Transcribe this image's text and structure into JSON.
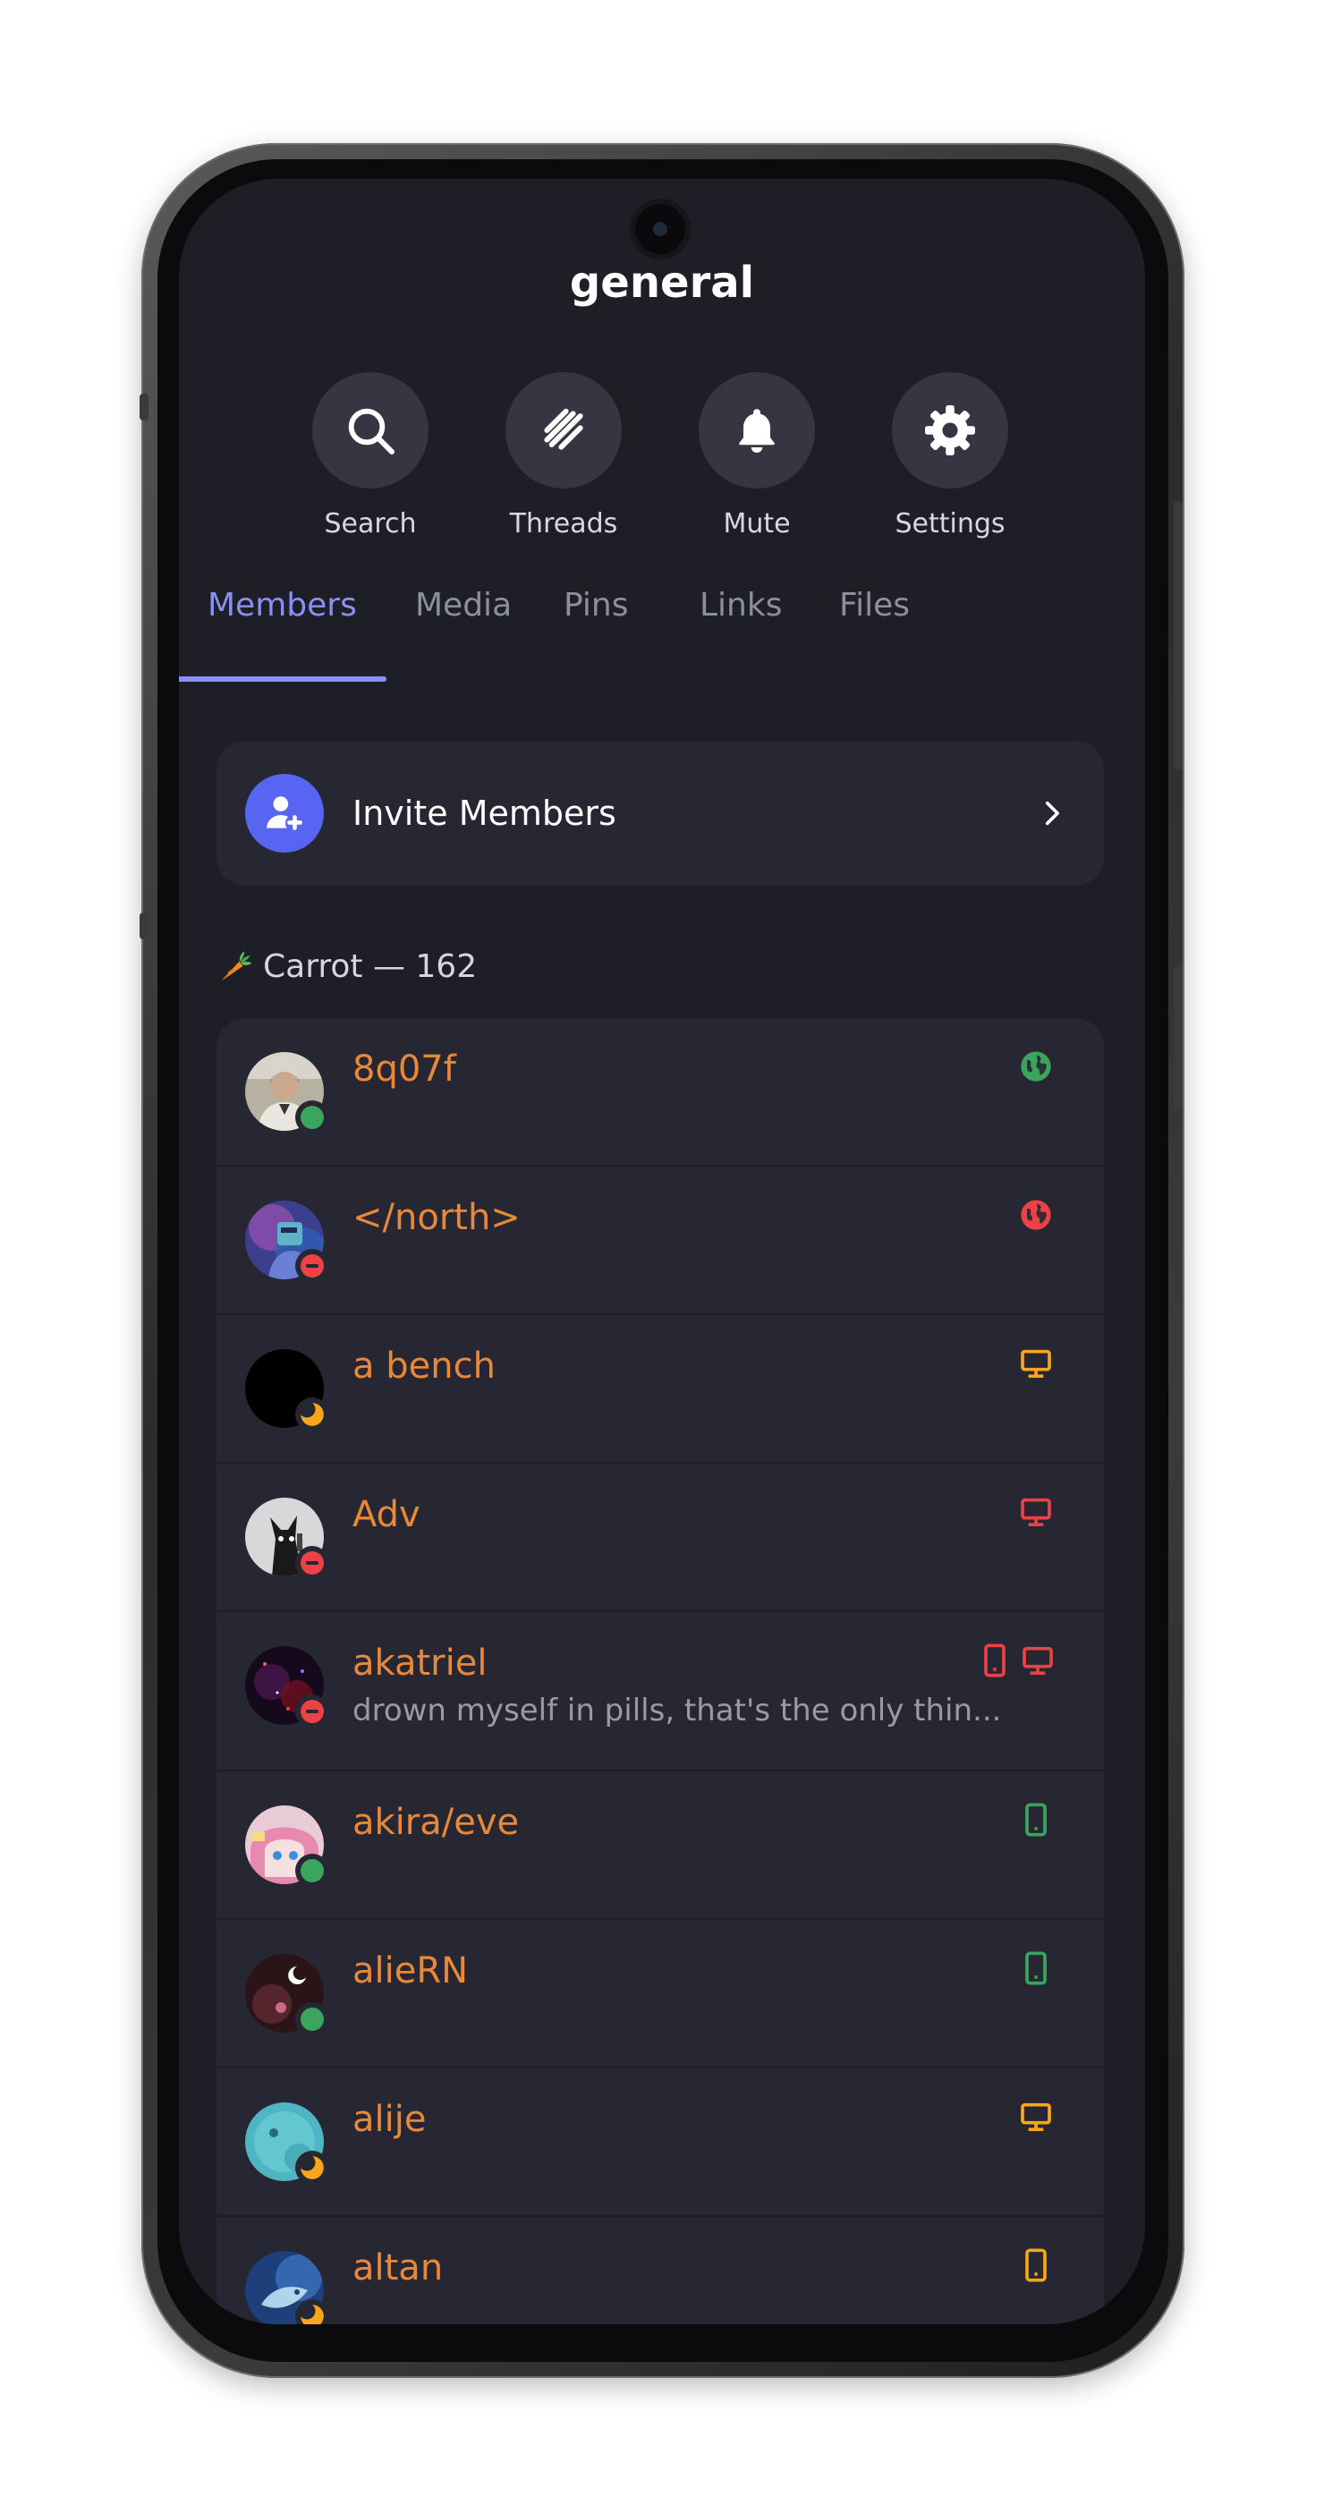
{
  "channel": {
    "title": "general"
  },
  "actions": [
    {
      "label": "Search",
      "icon": "search-icon"
    },
    {
      "label": "Threads",
      "icon": "threads-icon"
    },
    {
      "label": "Mute",
      "icon": "bell-icon"
    },
    {
      "label": "Settings",
      "icon": "gear-icon"
    }
  ],
  "tabs": [
    {
      "label": "Members",
      "active": true
    },
    {
      "label": "Media"
    },
    {
      "label": "Pins"
    },
    {
      "label": "Links"
    },
    {
      "label": "Files"
    }
  ],
  "invite": {
    "label": "Invite Members",
    "icon": "add-user-icon"
  },
  "role": {
    "emoji": "carrot-icon",
    "title": "Carrot — 162"
  },
  "members": [
    {
      "name": "8q07f",
      "status": "online",
      "device": "web",
      "device_color": "#3ba55d"
    },
    {
      "name": "</north>",
      "status": "dnd",
      "device": "web",
      "device_color": "#ed4245"
    },
    {
      "name": "a bench",
      "status": "idle",
      "device": "desktop",
      "device_color": "#faa61a"
    },
    {
      "name": "Adv",
      "status": "dnd",
      "device": "desktop",
      "device_color": "#ed4245"
    },
    {
      "name": "akatriel",
      "subtitle": "drown myself in pills, that's the only thin...",
      "status": "dnd",
      "device": "mobile+desktop",
      "device_color": "#ed4245"
    },
    {
      "name": "akira/eve",
      "status": "online",
      "device": "mobile",
      "device_color": "#3ba55d"
    },
    {
      "name": "alieRN",
      "status": "online",
      "device": "mobile",
      "device_color": "#3ba55d"
    },
    {
      "name": "alije",
      "status": "idle",
      "device": "desktop",
      "device_color": "#faa61a"
    },
    {
      "name": "altan",
      "status": "idle",
      "device": "mobile",
      "device_color": "#faa61a"
    }
  ],
  "colors": {
    "accent": "#8b8ff5",
    "blurple": "#5865f2",
    "role_color": "#e8893a",
    "online": "#3ba55d",
    "idle": "#faa61a",
    "dnd": "#ed4245"
  }
}
